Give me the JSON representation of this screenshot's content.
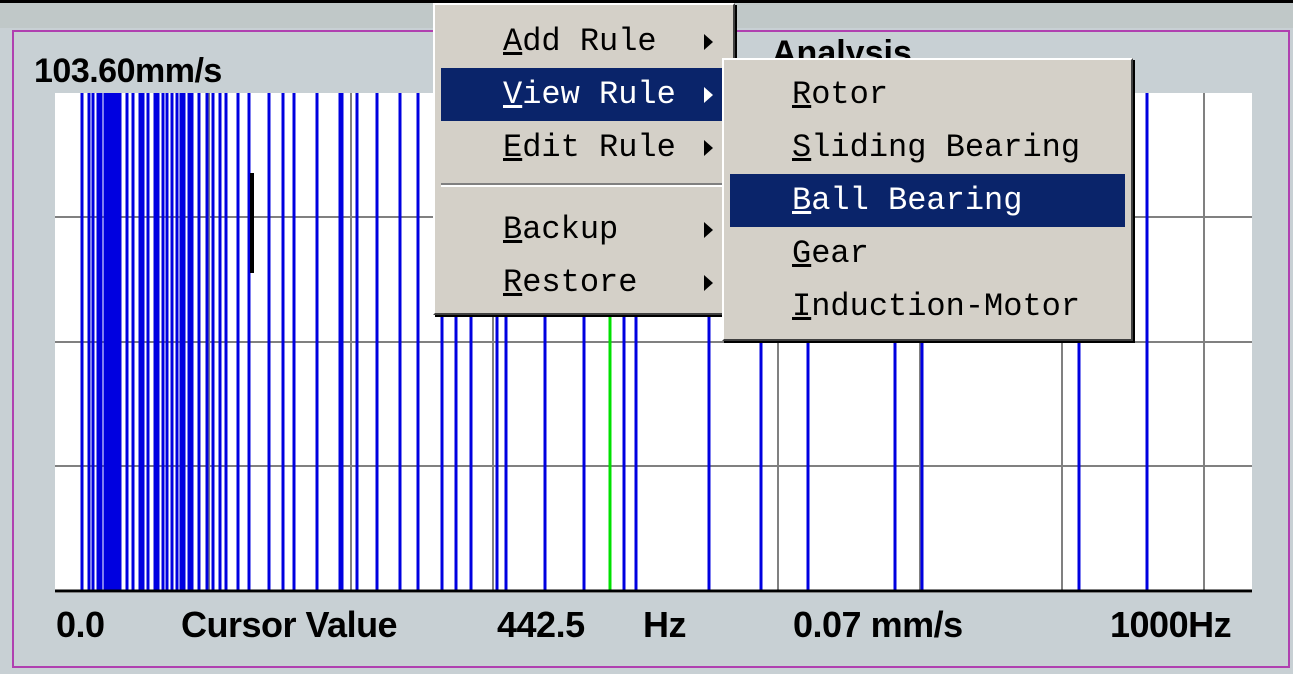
{
  "window": {
    "partial_title": "Analysis"
  },
  "spectrum": {
    "max_label": "103.60mm/s",
    "x_start": "0.0",
    "cursor_label": "Cursor Value",
    "cursor_freq": "442.5",
    "cursor_freq_unit": "Hz",
    "cursor_amp": "0.07 mm/s",
    "x_end": "1000Hz"
  },
  "context_menu": {
    "items": [
      {
        "mnemonic": "A",
        "rest": "dd Rule",
        "has_submenu": true,
        "highlighted": false
      },
      {
        "mnemonic": "V",
        "rest": "iew Rule",
        "has_submenu": true,
        "highlighted": true
      },
      {
        "mnemonic": "E",
        "rest": "dit Rule",
        "has_submenu": true,
        "highlighted": false
      },
      {
        "mnemonic": "B",
        "rest": "ackup",
        "has_submenu": true,
        "highlighted": false
      },
      {
        "mnemonic": "R",
        "rest": "estore",
        "has_submenu": true,
        "highlighted": false
      }
    ]
  },
  "submenu": {
    "items": [
      {
        "mnemonic": "R",
        "rest": "otor",
        "highlighted": false
      },
      {
        "mnemonic": "S",
        "rest": "liding Bearing",
        "highlighted": false
      },
      {
        "mnemonic": "B",
        "rest": "all Bearing",
        "highlighted": true
      },
      {
        "mnemonic": "G",
        "rest": "ear",
        "highlighted": false
      },
      {
        "mnemonic": "I",
        "rest": "nduction-Motor",
        "highlighted": false
      }
    ]
  },
  "colors": {
    "line_color": "#0000e0",
    "cursor_color": "#00e000",
    "grid_color": "#808080",
    "highlight": "#0a246a",
    "panel_border": "#b040b0"
  },
  "chart_data": {
    "type": "bar",
    "xlim": [
      0,
      1000
    ],
    "ylabel": "",
    "xlabel": "",
    "grid": true,
    "cursor_x": 442.5,
    "lines": [
      13,
      19,
      23,
      27,
      30,
      33,
      35,
      37,
      40,
      42,
      45,
      47,
      53,
      58,
      64,
      67,
      71,
      77,
      80,
      84,
      88,
      92,
      97,
      100,
      103,
      107,
      110,
      116,
      123,
      128,
      135,
      140,
      150,
      160,
      178,
      190,
      200,
      220,
      240,
      242,
      255,
      273,
      293,
      309,
      330,
      342,
      355,
      378,
      386,
      420,
      455,
      490,
      500,
      565,
      610,
      652,
      728,
      752,
      890,
      950
    ],
    "dark_lines": [
      160
    ]
  }
}
